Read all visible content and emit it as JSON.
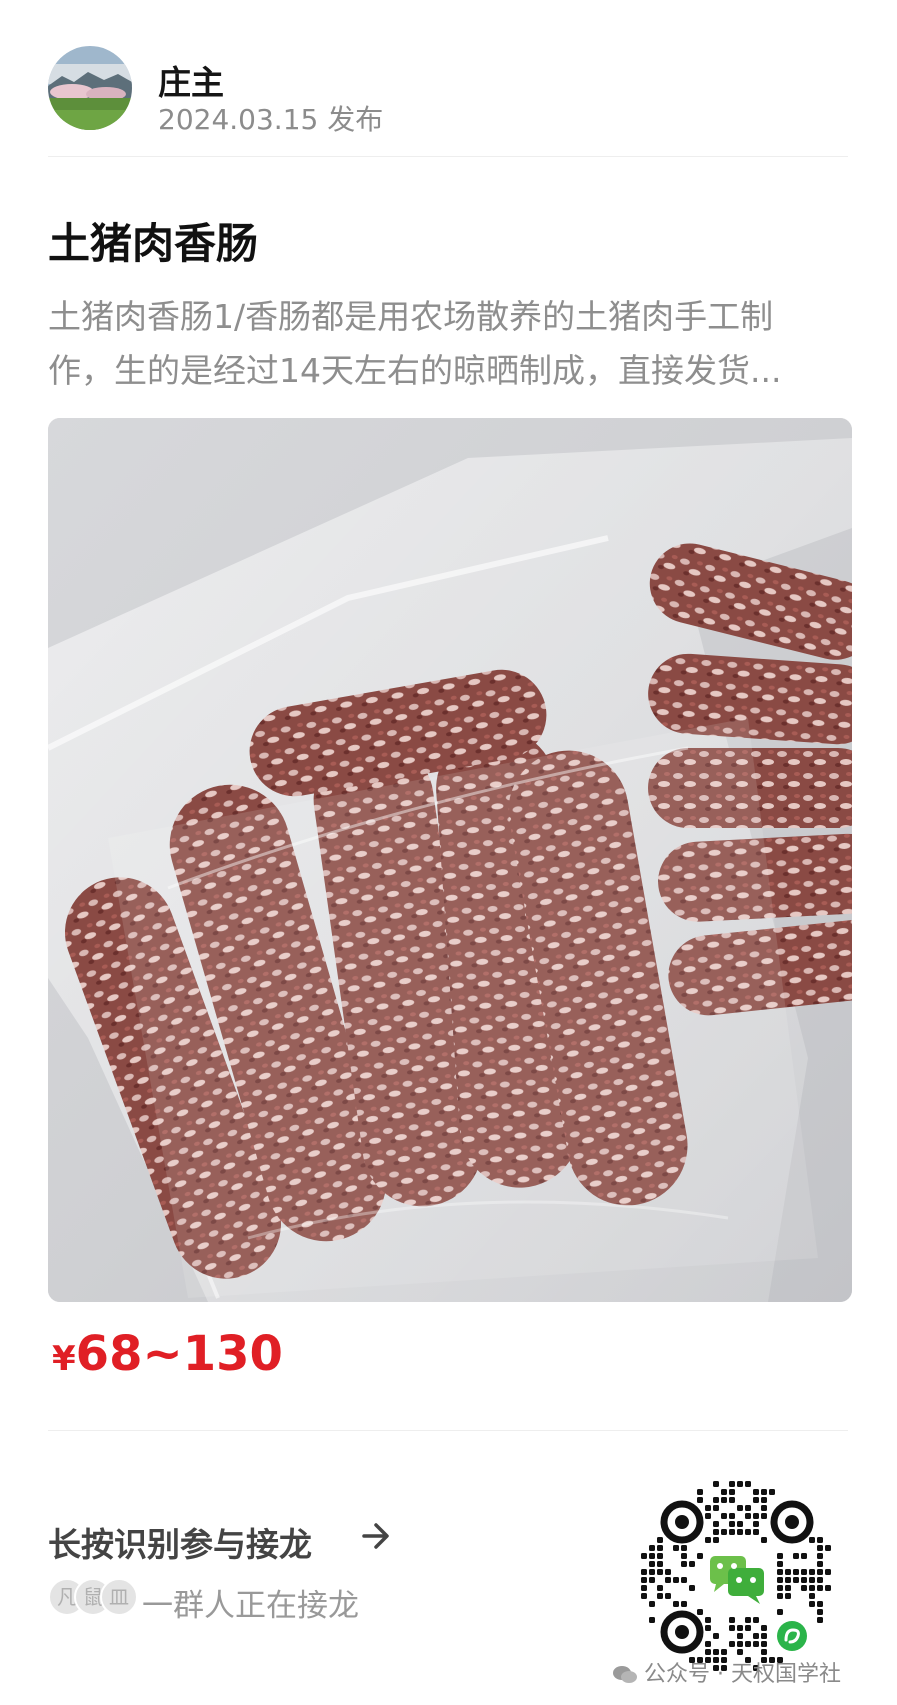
{
  "post": {
    "author": "庄主",
    "date": "2024.03.15",
    "published_label": "发布",
    "title": "土猪肉香肠",
    "description_line1": "土猪肉香肠1/香肠都是用农场散养的土猪肉手工制",
    "description_line2": "作，生的是经过14天左右的晾晒制成，直接发货...",
    "price_symbol": "¥",
    "price_range": "68~130"
  },
  "cta": {
    "label": "长按识别参与接龙",
    "participants_text": "一群人正在接龙",
    "avatar_glyphs": [
      "凡",
      "鼠",
      "皿"
    ]
  },
  "watermark": {
    "text": "公众号 · 天权国学社"
  },
  "icons": {
    "arrow": "arrow-right-icon",
    "qr": "mini-program-qr-icon",
    "wechat": "wechat-icon"
  },
  "colors": {
    "price": "#e01f25",
    "mini_program_green": "#2bb44a"
  }
}
